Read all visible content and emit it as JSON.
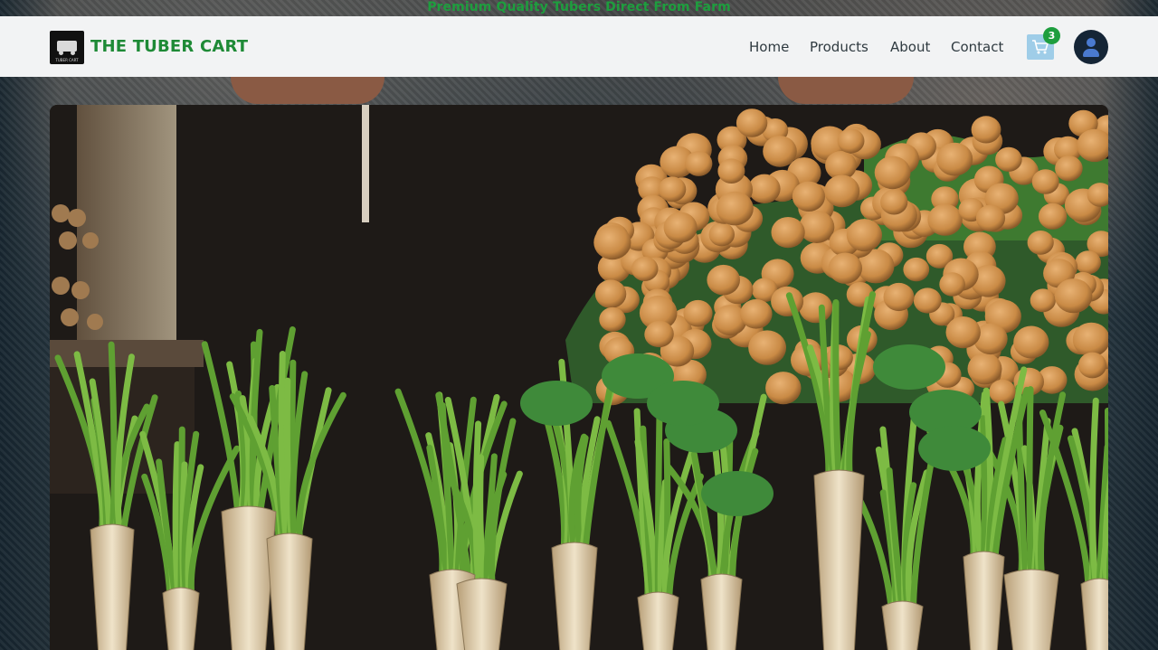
{
  "announcement": "Premium Quality Tubers Direct From Farm",
  "brand": {
    "name": "THE TUBER CART",
    "logo_caption": "TUBER CART"
  },
  "nav": {
    "links": [
      "Home",
      "Products",
      "About",
      "Contact"
    ]
  },
  "cart": {
    "count": "3",
    "icon": "cart-icon"
  },
  "user": {
    "icon": "user-avatar-icon"
  },
  "hero": {
    "image": "fresh-tubers-and-potatoes-photo"
  },
  "colors": {
    "brand_green": "#1e8a36",
    "badge_green": "#1e9e3e",
    "navbar_bg": "#f2f3f4",
    "cart_bg": "#9fcde8"
  }
}
